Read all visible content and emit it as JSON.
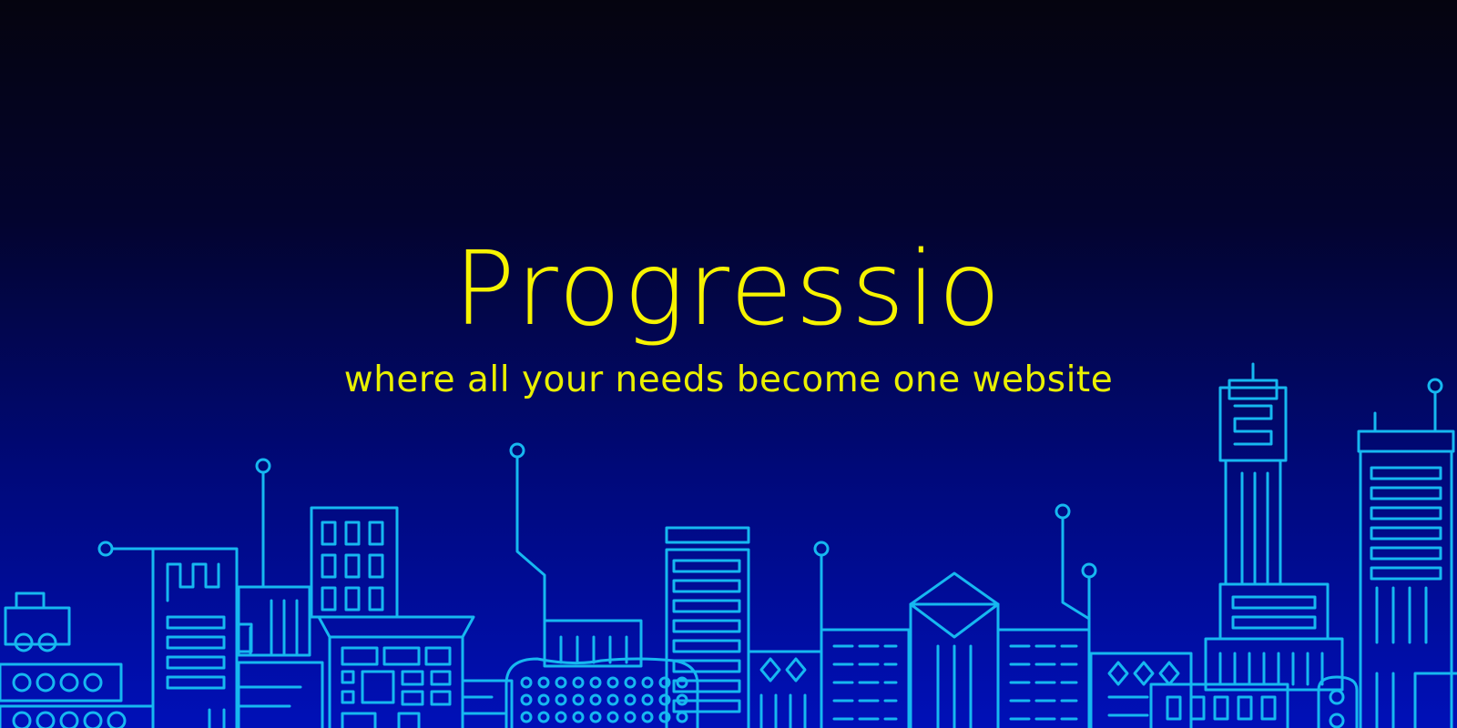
{
  "brand": {
    "name": "Progressio",
    "tagline": "where all your needs become one website"
  },
  "colors": {
    "background_top": "#05040f",
    "background_bottom": "#0010b8",
    "text_accent": "#f6f300",
    "line_art": "#16b8f0"
  },
  "illustration": "city-skyline"
}
